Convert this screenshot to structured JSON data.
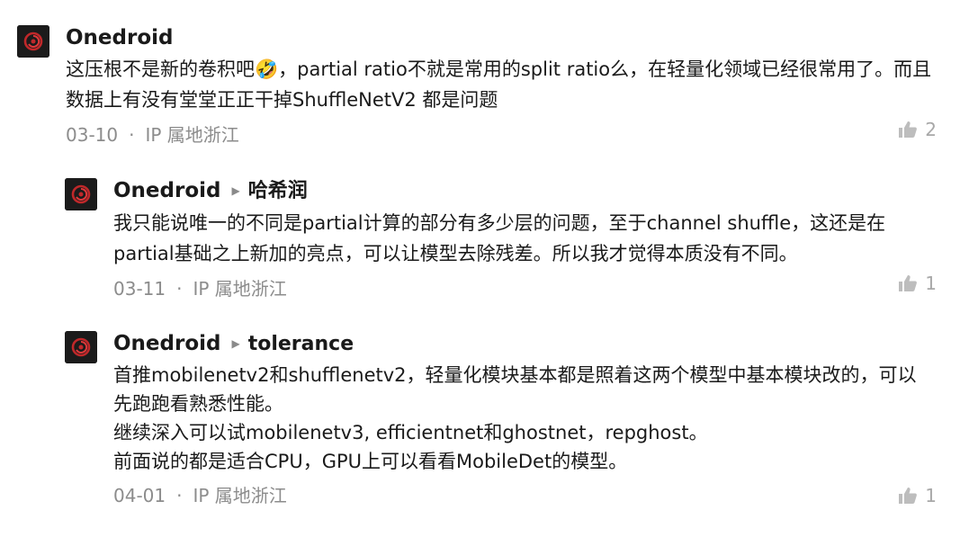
{
  "comments": [
    {
      "author": "Onedroid",
      "reply_to": "",
      "paragraphs": [
        "这压根不是新的卷积吧🤣，partial ratio不就是常用的split ratio么，在轻量化领域已经很常用了。而且数据上有没有堂堂正正干掉ShuffleNetV2 都是问题"
      ],
      "date": "03-10",
      "separator": "·",
      "location": "IP 属地浙江",
      "likes": "2"
    },
    {
      "author": "Onedroid",
      "reply_to": "哈希润",
      "paragraphs": [
        "我只能说唯一的不同是partial计算的部分有多少层的问题，至于channel shuffle，这还是在partial基础之上新加的亮点，可以让模型去除残差。所以我才觉得本质没有不同。"
      ],
      "date": "03-11",
      "separator": "·",
      "location": "IP 属地浙江",
      "likes": "1"
    },
    {
      "author": "Onedroid",
      "reply_to": "tolerance",
      "paragraphs": [
        "首推mobilenetv2和shufflenetv2，轻量化模块基本都是照着这两个模型中基本模块改的，可以先跑跑看熟悉性能。",
        "继续深入可以试mobilenetv3, efficientnet和ghostnet，repghost。",
        "前面说的都是适合CPU，GPU上可以看看MobileDet的模型。"
      ],
      "date": "04-01",
      "separator": "·",
      "location": "IP 属地浙江",
      "likes": "1"
    }
  ],
  "icons": {
    "like": "thumbs-up-icon",
    "reply_arrow": "caret-right-icon",
    "avatar": "spiral-avatar"
  },
  "colors": {
    "meta": "#8c8c8c",
    "avatar_bg": "#1b1b1b",
    "avatar_swirl": "#c0282a"
  }
}
